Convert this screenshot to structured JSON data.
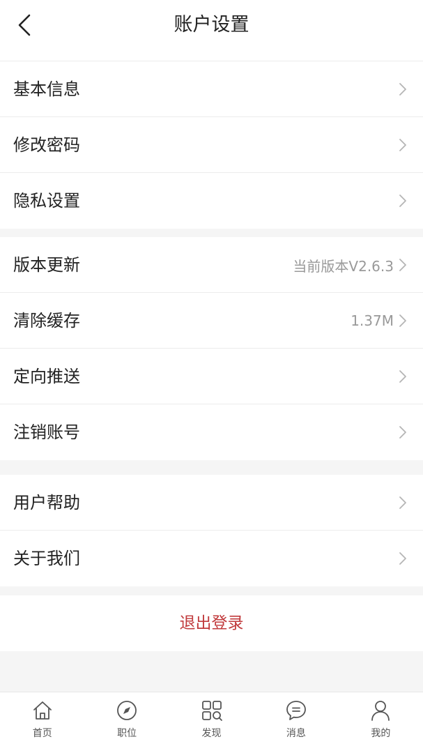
{
  "header": {
    "title": "账户设置",
    "back_icon": "chevron-left-icon"
  },
  "groups": [
    {
      "items": [
        {
          "label": "基本信息",
          "value": ""
        },
        {
          "label": "修改密码",
          "value": ""
        },
        {
          "label": "隐私设置",
          "value": ""
        }
      ]
    },
    {
      "items": [
        {
          "label": "版本更新",
          "value": "当前版本V2.6.3"
        },
        {
          "label": "清除缓存",
          "value": "1.37M"
        },
        {
          "label": "定向推送",
          "value": ""
        },
        {
          "label": "注销账号",
          "value": ""
        }
      ]
    },
    {
      "items": [
        {
          "label": "用户帮助",
          "value": ""
        },
        {
          "label": "关于我们",
          "value": ""
        }
      ]
    }
  ],
  "logout_label": "退出登录",
  "tabbar": [
    {
      "label": "首页",
      "icon": "home-icon"
    },
    {
      "label": "职位",
      "icon": "compass-icon"
    },
    {
      "label": "发现",
      "icon": "grid-search-icon"
    },
    {
      "label": "消息",
      "icon": "chat-bubble-icon"
    },
    {
      "label": "我的",
      "icon": "user-icon"
    }
  ],
  "colors": {
    "logout": "#c0393b",
    "secondary_text": "#999999",
    "background": "#f5f5f5"
  }
}
